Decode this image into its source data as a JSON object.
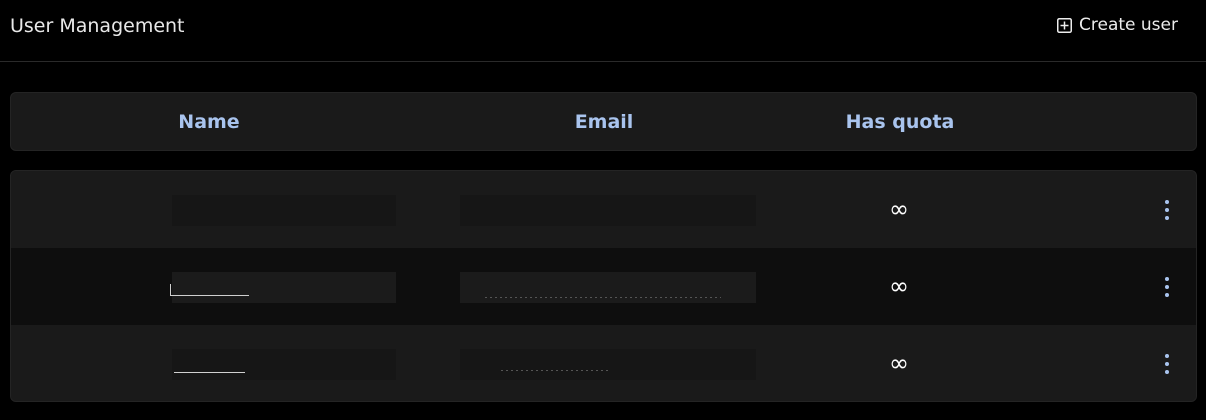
{
  "header": {
    "title": "User Management",
    "create_label": "Create user",
    "create_icon": "plus-square-icon"
  },
  "table": {
    "columns": [
      "Name",
      "Email",
      "Has quota"
    ],
    "rows": [
      {
        "name": "",
        "email": "",
        "quota": "∞"
      },
      {
        "name": "",
        "email": "",
        "quota": "∞"
      },
      {
        "name": "",
        "email": "",
        "quota": "∞"
      }
    ],
    "row_menu_icon": "more-vertical-icon"
  },
  "colors": {
    "background": "#000000",
    "card": "#1a1a1a",
    "alt_row": "#0e0e0e",
    "accent": "#a9c4ee",
    "text": "#e8e8e8"
  }
}
